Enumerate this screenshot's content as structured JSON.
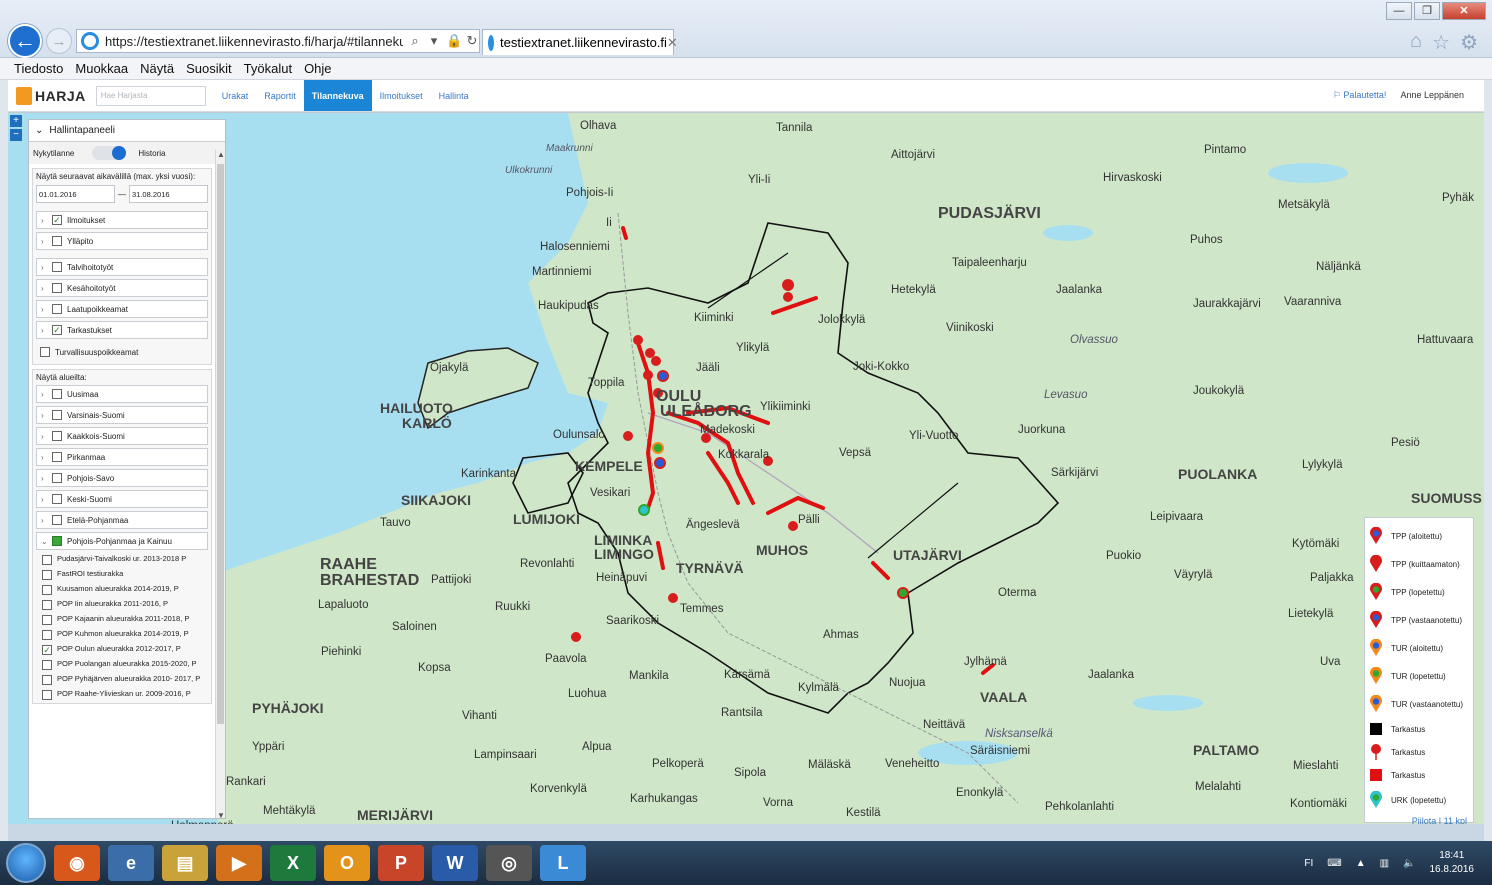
{
  "browser": {
    "url": "https://testiextranet.liikennevirasto.fi/harja/#tilannekuva?&",
    "tab_title": "testiextranet.liikennevirasto.fi",
    "menu": [
      "Tiedosto",
      "Muokkaa",
      "Näytä",
      "Suosikit",
      "Työkalut",
      "Ohje"
    ]
  },
  "app": {
    "logo": "HARJA",
    "search_placeholder": "Hae Harjasta",
    "nav": [
      "Urakat",
      "Raportit",
      "Tilannekuva",
      "Ilmoitukset",
      "Hallinta"
    ],
    "active_nav": "Tilannekuva",
    "feedback": "Palautetta!",
    "user": "Anne Leppänen"
  },
  "panel": {
    "title": "Hallintapaneeli",
    "toggle_left": "Nykytilanne",
    "toggle_right": "Historia",
    "date_label": "Näytä seuraavat aikavälillä (max. yksi vuosi):",
    "date_from": "01.01.2016",
    "date_sep": "—",
    "date_to": "31.08.2016",
    "layers": [
      {
        "label": "Ilmoitukset",
        "checked": true
      },
      {
        "label": "Ylläpito",
        "checked": false
      },
      {
        "label": "Talvihoitotyöt",
        "checked": false
      },
      {
        "label": "Kesähoitotyöt",
        "checked": false
      },
      {
        "label": "Laatupoikkeamat",
        "checked": false
      },
      {
        "label": "Tarkastukset",
        "checked": true
      }
    ],
    "safety_label": "Turvallisuuspoikkeamat",
    "area_label": "Näytä alueilta:",
    "areas": [
      "Uusimaa",
      "Varsinais-Suomi",
      "Kaakkois-Suomi",
      "Pirkanmaa",
      "Pohjois-Savo",
      "Keski-Suomi",
      "Etelä-Pohjanmaa",
      "Pohjois-Pohjanmaa ja Kainuu"
    ],
    "contracts": [
      {
        "label": "Pudasjärvi-Taivalkoski ur. 2013-2018 P",
        "checked": false
      },
      {
        "label": "FastROI testiurakka",
        "checked": false
      },
      {
        "label": "Kuusamon alueurakka 2014-2019, P",
        "checked": false
      },
      {
        "label": "POP Iin alueurakka 2011-2016, P",
        "checked": false
      },
      {
        "label": "POP Kajaanin alueurakka 2011-2018, P",
        "checked": false
      },
      {
        "label": "POP Kuhmon alueurakka 2014-2019, P",
        "checked": false
      },
      {
        "label": "POP Oulun alueurakka 2012-2017, P",
        "checked": true
      },
      {
        "label": "POP Puolangan alueurakka 2015-2020, P",
        "checked": false
      },
      {
        "label": "POP Pyhäjärven alueurakka 2010- 2017, P",
        "checked": false
      },
      {
        "label": "POP Raahe-Ylivieskan ur. 2009-2016, P",
        "checked": false
      }
    ]
  },
  "legend": {
    "items": [
      {
        "label": "TPP (aloitettu)",
        "color": "#d91c1c",
        "inner": "#2a5bd6"
      },
      {
        "label": "TPP (kuittaamaton)",
        "color": "#d91c1c",
        "inner": "#d91c1c"
      },
      {
        "label": "TPP (lopetettu)",
        "color": "#d91c1c",
        "inner": "#2ea82e"
      },
      {
        "label": "TPP (vastaanotettu)",
        "color": "#d91c1c",
        "inner": "#2a5bd6"
      },
      {
        "label": "TUR (aloitettu)",
        "color": "#f08a1c",
        "inner": "#2a5bd6"
      },
      {
        "label": "TUR (lopetettu)",
        "color": "#f08a1c",
        "inner": "#2ea82e"
      },
      {
        "label": "TUR (vastaanotettu)",
        "color": "#f08a1c",
        "inner": "#2a5bd6"
      },
      {
        "label": "Tarkastus",
        "shape": "square-black"
      },
      {
        "label": "Tarkastus",
        "shape": "pin-red"
      },
      {
        "label": "Tarkastus",
        "shape": "square-red"
      },
      {
        "label": "URK (lopetettu)",
        "color": "#2ec3c8",
        "inner": "#2ea82e"
      }
    ],
    "hide": "Piilota",
    "count": "11 kpl"
  },
  "map": {
    "places": [
      "Olhava",
      "Tannila",
      "Maakrunni",
      "Aittojärvi",
      "Pintamo",
      "Ulkokrunni",
      "Yli-Ii",
      "Hirvaskoski",
      "Pohjois-Ii",
      "Pyhäk",
      "Ii",
      "PUDASJÄRVI",
      "Metsäkylä",
      "Halosenniemi",
      "Puhos",
      "Martinniemi",
      "Taipaleenharju",
      "Näljänkä",
      "Hetekylä",
      "Jaalanka",
      "Haukipudas",
      "Jaurakkajärvi",
      "Vaaranniva",
      "Kiiminki",
      "Jolokkylä",
      "Viinikoski",
      "Olvassuo",
      "Hattuvaara",
      "Ylikylä",
      "Ojakylä",
      "Jääli",
      "Joki-Kokko",
      "Toppila",
      "HAILUOTO KARLÖ",
      "Levasuo",
      "Joukokylä",
      "OULU ULEÅBORG",
      "Ylikiiminki",
      "Madekoski",
      "Oulunsalo",
      "Yli-Vuotto",
      "Juorkuna",
      "Pesiö",
      "Vepsä",
      "Karinkanta",
      "Lylykylä",
      "Särkijärvi",
      "PUOLANKA",
      "KEMPELE",
      "Kokkarala",
      "SIIKAJOKI",
      "Vesikari",
      "SUOMUSS",
      "Tauvo",
      "LUMIJOKI",
      "Ängeslevä",
      "Pälli",
      "Leipivaara",
      "LIMINKA LIMINGO",
      "MUHOS",
      "UTAJÄRVI",
      "Kytömäki",
      "RAAHE BRAHESTAD",
      "Revonlahti",
      "TYRNÄVÄ",
      "Puokio",
      "Väyrylä",
      "Paljakka",
      "Pattijoki",
      "Heinäpuvi",
      "Lapaluoto",
      "Ruukki",
      "Temmes",
      "Oterma",
      "Lietekylä",
      "Saloinen",
      "Saarikoski",
      "Ahmas",
      "Piehinki",
      "Kopsa",
      "Paavola",
      "Jylhämä",
      "Uva",
      "Mankila",
      "Kärsämä",
      "Nuojua",
      "Luohua",
      "Kylmälä",
      "VAALA",
      "Jaalanka",
      "PYHÄJOKI",
      "Vihanti",
      "Rantsila",
      "Neittävä",
      "Nisksanselkä",
      "Yppäri",
      "Lampinsaari",
      "Alpua",
      "Säräisniemi",
      "PALTAMO",
      "Mieslahti",
      "Pelkoperä",
      "Sipola",
      "Mäläskä",
      "Veneheitto",
      "Melalahti",
      "Enonkylä",
      "Korvenkylä",
      "Karhukangas",
      "Vorna",
      "Kestilä",
      "Pehkolanlahti",
      "Kontiomäki",
      "Mehtäkylä",
      "MERIJÄRVI",
      "Holmanperä",
      "Rankari"
    ]
  },
  "taskbar": {
    "lang": "FI",
    "time": "18:41",
    "date": "16.8.2016"
  }
}
